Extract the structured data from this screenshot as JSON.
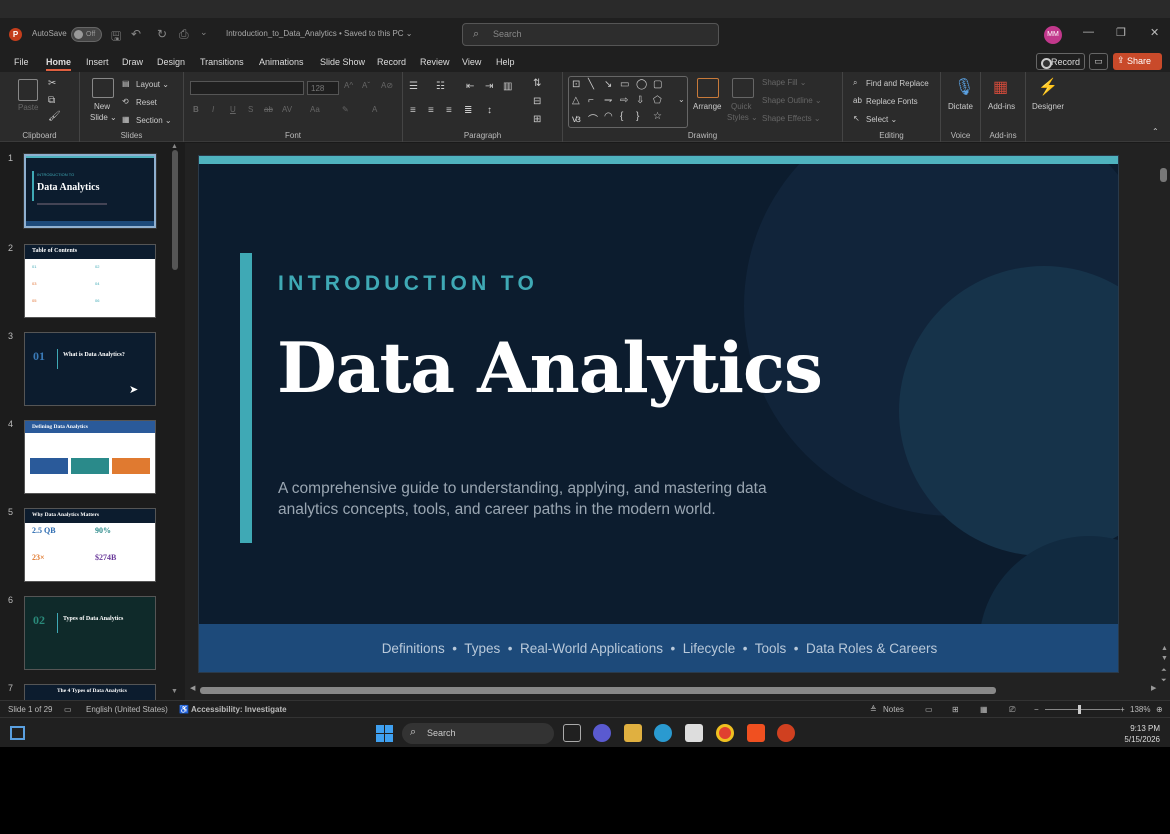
{
  "titlebar": {
    "autosave_label": "AutoSave",
    "autosave_state": "Off",
    "doc_title": "Introduction_to_Data_Analytics • Saved to this PC ⌄",
    "search_placeholder": "Search",
    "avatar_initials": "MM"
  },
  "menu": {
    "items": [
      "File",
      "Home",
      "Insert",
      "Draw",
      "Design",
      "Transitions",
      "Animations",
      "Slide Show",
      "Record",
      "Review",
      "View",
      "Help"
    ],
    "active": "Home",
    "record_label": "Record",
    "share_label": "Share"
  },
  "ribbon": {
    "clipboard": {
      "label": "Clipboard",
      "paste": "Paste"
    },
    "slides": {
      "label": "Slides",
      "new_slide": "New",
      "new_slide2": "Slide ⌄",
      "layout": "Layout ⌄",
      "reset": "Reset",
      "section": "Section ⌄"
    },
    "font": {
      "label": "Font",
      "size": "128"
    },
    "paragraph": {
      "label": "Paragraph"
    },
    "drawing": {
      "label": "Drawing",
      "arrange": "Arrange",
      "quick_styles": "Quick",
      "quick_styles2": "Styles ⌄",
      "shape_fill": "Shape Fill ⌄",
      "shape_outline": "Shape Outline ⌄",
      "shape_effects": "Shape Effects ⌄"
    },
    "editing": {
      "label": "Editing",
      "find_replace": "Find and Replace",
      "replace_fonts": "Replace Fonts",
      "select": "Select ⌄"
    },
    "voice": {
      "label": "Voice",
      "dictate": "Dictate"
    },
    "addins": {
      "label": "Add-ins",
      "addins": "Add-ins"
    },
    "designer": {
      "label": "Designer"
    }
  },
  "thumbnails": [
    {
      "num": "1",
      "kicker": "INTRODUCTION TO",
      "title": "Data Analytics"
    },
    {
      "num": "2",
      "title": "Table of Contents",
      "cells": [
        "01",
        "02",
        "03",
        "04",
        "05",
        "06"
      ]
    },
    {
      "num": "3",
      "title": "What is Data Analytics?",
      "index": "01"
    },
    {
      "num": "4",
      "title": "Defining Data Analytics"
    },
    {
      "num": "5",
      "title": "Why Data Analytics Matters",
      "stats": [
        "2.5 QB",
        "90%",
        "23×",
        "$274B"
      ]
    },
    {
      "num": "6",
      "title": "Types of Data Analytics",
      "index": "02"
    },
    {
      "num": "7",
      "title": "The 4 Types of Data Analytics"
    }
  ],
  "slide": {
    "kicker": "INTRODUCTION TO",
    "title": "Data Analytics",
    "subtitle": "A comprehensive guide to understanding, applying, and mastering data analytics concepts, tools, and career paths in the modern world.",
    "footer": "Definitions  •  Types  •  Real-World Applications  •  Lifecycle  •  Tools  •  Data Roles & Careers",
    "colors": {
      "background": "#0c1c2e",
      "accent": "#3fa9b5",
      "footer_band": "#1d4a7a"
    }
  },
  "status": {
    "slide_of": "Slide 1 of 29",
    "language": "English (United States)",
    "accessibility": "Accessibility: Investigate",
    "notes": "Notes",
    "zoom": "138%"
  },
  "taskbar": {
    "search": "Search",
    "time": "9:13 PM",
    "date": "5/15/2026"
  }
}
